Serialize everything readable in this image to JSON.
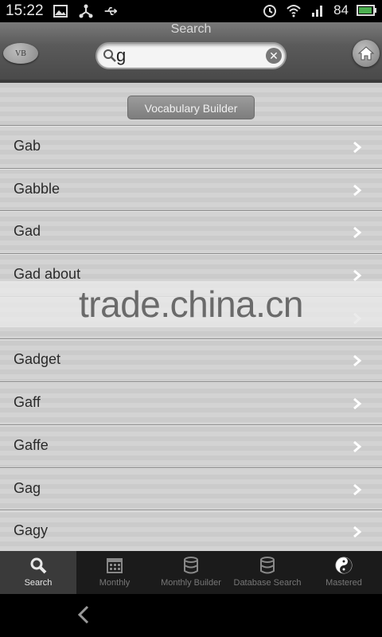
{
  "status_bar": {
    "time": "15:22",
    "battery_percent": "84",
    "icons": [
      "image-icon",
      "usb-debug-icon",
      "usb-icon",
      "alarm-icon",
      "wifi-icon",
      "3g-signal-icon",
      "battery-icon"
    ]
  },
  "header": {
    "title": "Search",
    "badge": "VB",
    "search_value": "g"
  },
  "section": {
    "button_label": "Vocabulary Builder"
  },
  "list": [
    {
      "word": "Gab"
    },
    {
      "word": "Gabble"
    },
    {
      "word": "Gad"
    },
    {
      "word": "Gad about"
    },
    {
      "word": ""
    },
    {
      "word": "Gadget"
    },
    {
      "word": "Gaff"
    },
    {
      "word": "Gaffe"
    },
    {
      "word": "Gag"
    },
    {
      "word": "Gagy"
    }
  ],
  "watermark": "trade.china.cn",
  "tabs": [
    {
      "label": "Search",
      "icon": "search-icon"
    },
    {
      "label": "Monthly",
      "icon": "calendar-icon"
    },
    {
      "label": "Monthly Builder",
      "icon": "database-icon"
    },
    {
      "label": "Database Search",
      "icon": "database-icon"
    },
    {
      "label": "Mastered",
      "icon": "yin-yang-icon"
    }
  ],
  "colors": {
    "active_tab": "#3a3a3a",
    "tab_bar": "#1b1b1b",
    "list_stripe_a": "#cbcbcb",
    "list_stripe_b": "#d3d3d3"
  }
}
